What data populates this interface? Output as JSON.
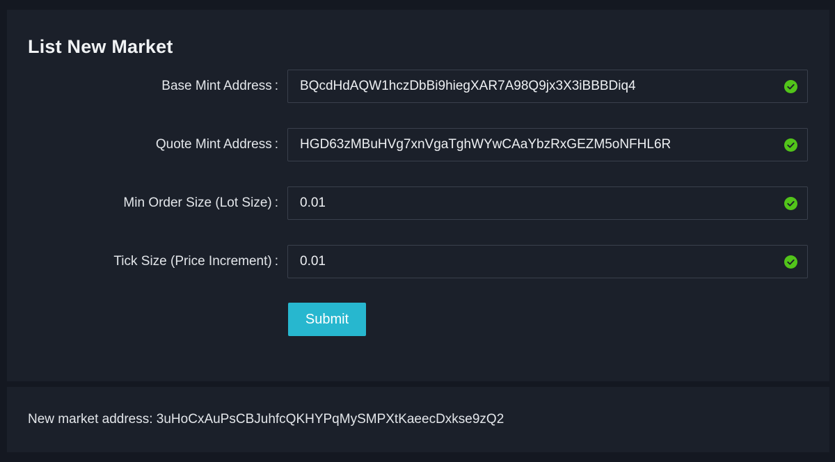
{
  "form": {
    "title": "List New Market",
    "fields": [
      {
        "label": "Base Mint Address",
        "colon": ":",
        "value": "BQcdHdAQW1hczDbBi9hiegXAR7A98Q9jx3X3iBBBDiq4",
        "valid": true
      },
      {
        "label": "Quote Mint Address",
        "colon": ":",
        "value": "HGD63zMBuHVg7xnVgaTghWYwCAaYbzRxGEZM5oNFHL6R",
        "valid": true
      },
      {
        "label": "Min Order Size (Lot Size)",
        "colon": ":",
        "value": "0.01",
        "valid": true
      },
      {
        "label": "Tick Size (Price Increment)",
        "colon": ":",
        "value": "0.01",
        "valid": true
      }
    ],
    "submit_label": "Submit"
  },
  "result": {
    "label": "New market address:",
    "address": "3uHoCxAuPsCBJuhfcQKHYPqMySMPXtKaeecDxkse9zQ2"
  },
  "colors": {
    "page_background": "#141821",
    "card_background": "#1b202a",
    "input_border": "#3a404c",
    "accent": "#27b7cf",
    "valid_icon": "#52c41a",
    "text": "#e3e6ea"
  },
  "icons": {
    "valid": "check-circle-icon"
  }
}
